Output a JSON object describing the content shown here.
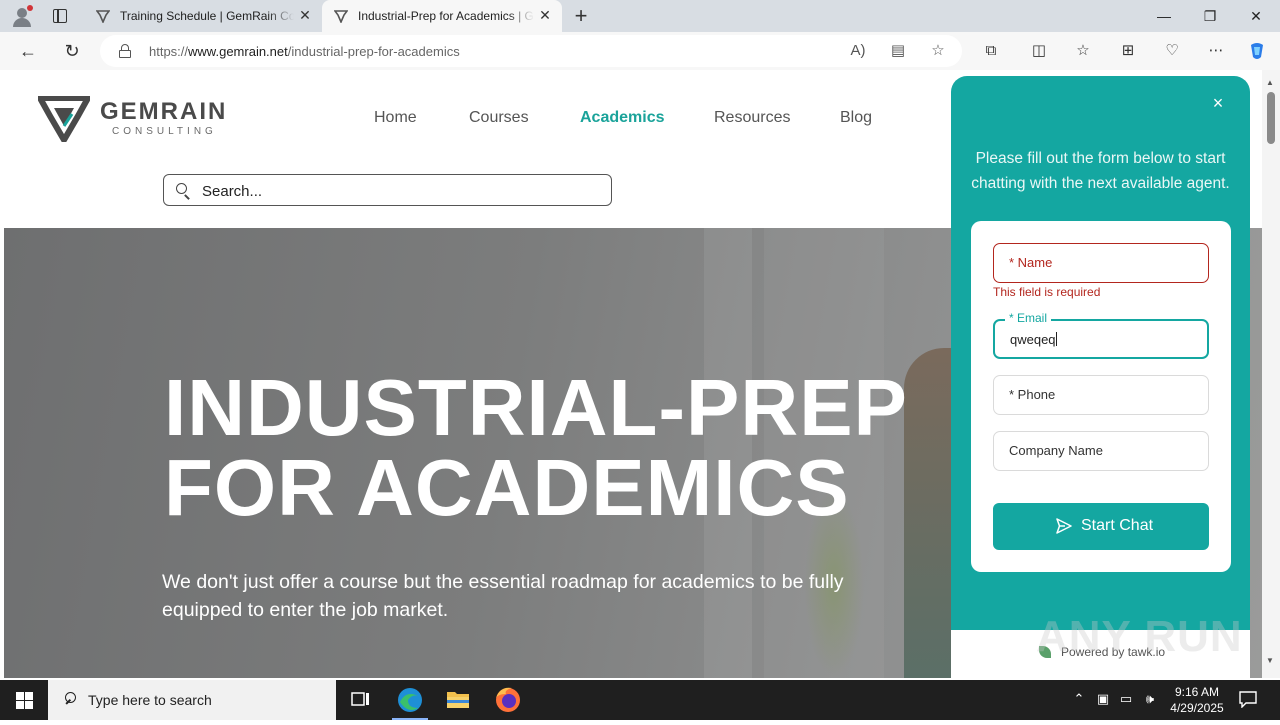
{
  "browser": {
    "tabs": [
      {
        "title": "Training Schedule | GemRain Con",
        "active": false
      },
      {
        "title": "Industrial-Prep for Academics | G",
        "active": true
      }
    ],
    "url_prefix": "https://",
    "url_domain": "www.gemrain.net",
    "url_path": "/industrial-prep-for-academics"
  },
  "site": {
    "logo_brand": "GEMRAIN",
    "logo_sub": "CONSULTING",
    "nav": [
      {
        "label": "Home",
        "active": false
      },
      {
        "label": "Courses",
        "active": false
      },
      {
        "label": "Academics",
        "active": true
      },
      {
        "label": "Resources",
        "active": false
      },
      {
        "label": "Blog",
        "active": false
      }
    ],
    "search_placeholder": "Search...",
    "hero_title_line1": "INDUSTRIAL-PREP",
    "hero_title_line2": "FOR ACADEMICS",
    "hero_text": "We don't just offer a course but the essential roadmap for academics to be fully equipped to enter the job market."
  },
  "chat": {
    "close": "×",
    "intro": "Please fill out the form below to start chatting with the next available agent.",
    "name_placeholder": "* Name",
    "name_error": "This field is required",
    "email_label": "* Email",
    "email_value": "qweqeq",
    "phone_placeholder": "* Phone",
    "company_placeholder": "Company Name",
    "start_label": "Start Chat",
    "powered_by": "Powered by tawk.io"
  },
  "watermark": "ANY RUN",
  "taskbar": {
    "search_placeholder": "Type here to search",
    "time": "9:16 AM",
    "date": "4/29/2025"
  },
  "colors": {
    "teal": "#14a7a1",
    "nav_active": "#1aa39a",
    "error": "#b3261e"
  }
}
